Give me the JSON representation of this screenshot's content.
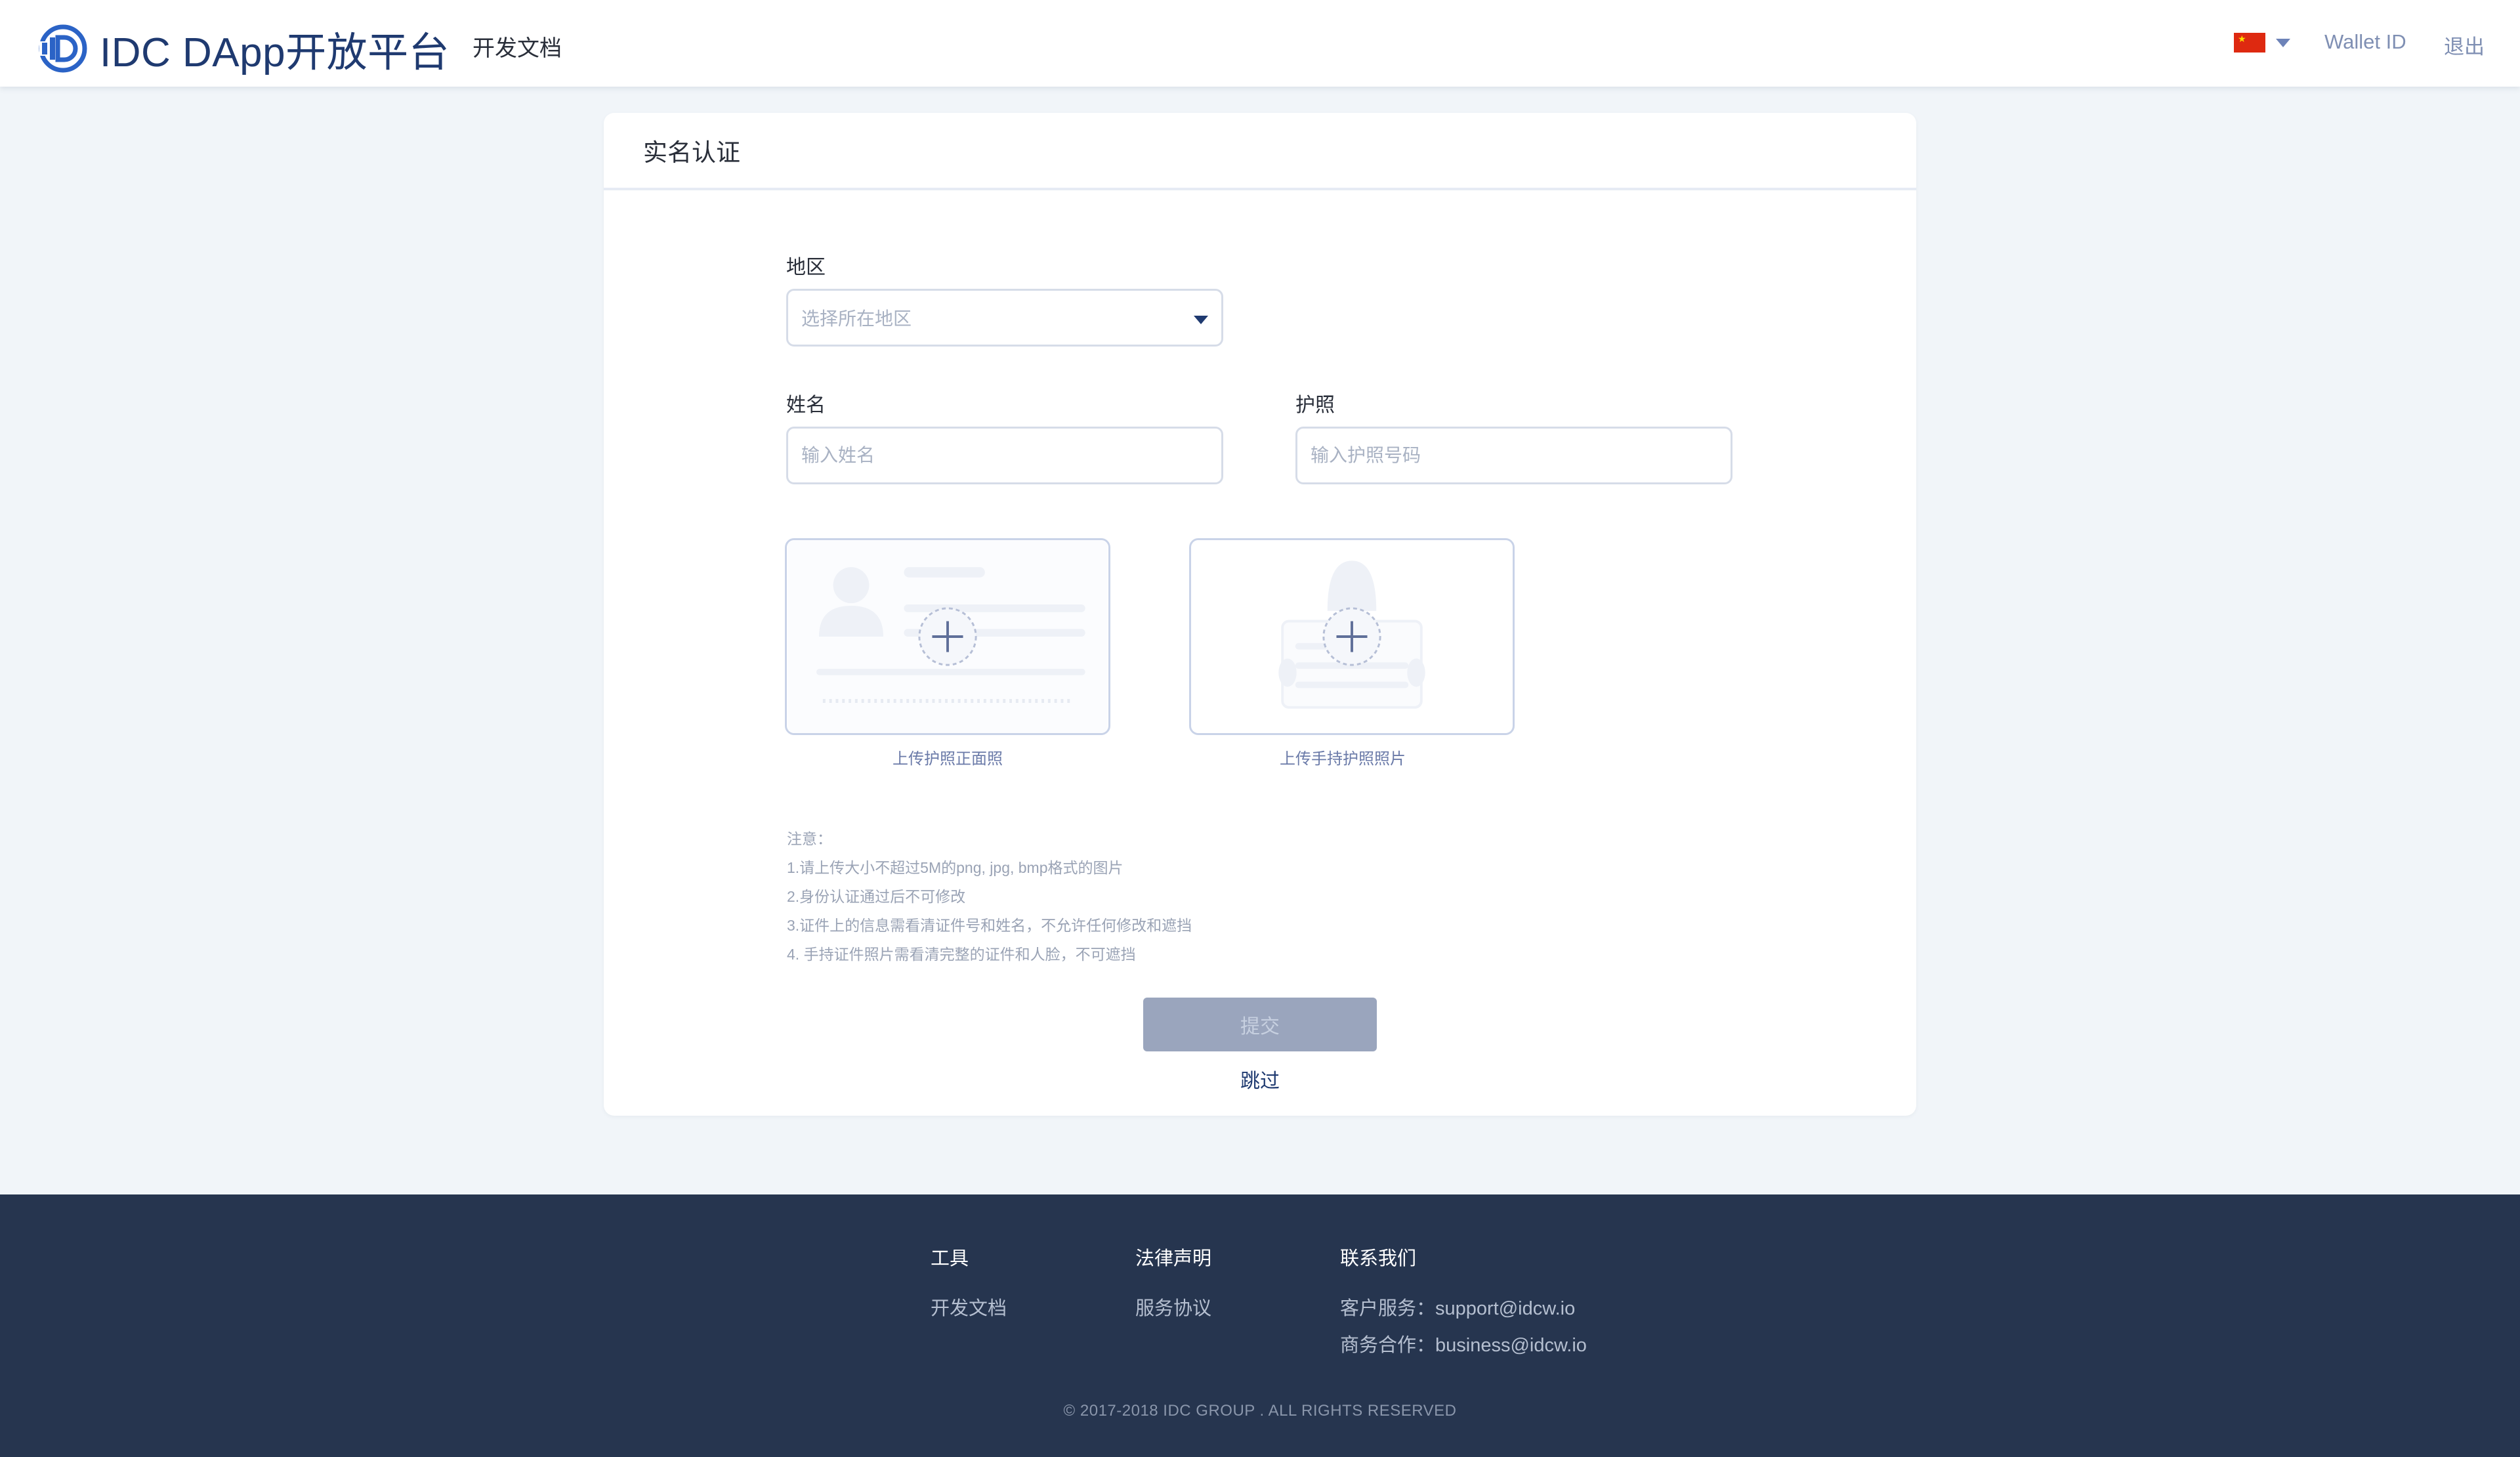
{
  "header": {
    "brand": "IDC DApp开放平台",
    "nav_docs": "开发文档",
    "language_flag": "china-flag",
    "wallet_id": "Wallet ID",
    "logout": "退出",
    "brand_color": "#1f3a70"
  },
  "card": {
    "title": "实名认证",
    "region": {
      "label": "地区",
      "placeholder": "选择所在地区"
    },
    "name": {
      "label": "姓名",
      "placeholder": "输入姓名"
    },
    "passport": {
      "label": "护照",
      "placeholder": "输入护照号码"
    },
    "uploads": [
      {
        "caption": "上传护照正面照",
        "icon": "passport-front-placeholder-icon"
      },
      {
        "caption": "上传手持护照照片",
        "icon": "holding-passport-placeholder-icon"
      }
    ],
    "notes": [
      "注意：",
      "1.请上传大小不超过5M的png, jpg, bmp格式的图片",
      "2.身份认证通过后不可修改",
      "3.证件上的信息需看清证件号和姓名，不允许任何修改和遮挡",
      "4. 手持证件照片需看清完整的证件和人脸，不可遮挡"
    ],
    "submit": "提交",
    "skip": "跳过"
  },
  "footer": {
    "tools": {
      "heading": "工具",
      "links": [
        "开发文档"
      ]
    },
    "legal": {
      "heading": "法律声明",
      "links": [
        "服务协议"
      ]
    },
    "contact": {
      "heading": "联系我们",
      "links": [
        "客户服务：support@idcw.io",
        "商务合作：business@idcw.io"
      ]
    },
    "copyright": "© 2017-2018 IDC GROUP . ALL RIGHTS RESERVED",
    "background": "#26354f"
  }
}
